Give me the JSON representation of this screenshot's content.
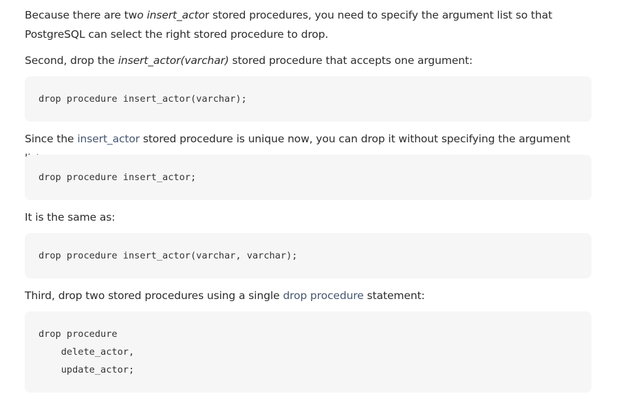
{
  "p1": {
    "t1": "Because there are tw",
    "t2": "o insert_acto",
    "t3": "r stored procedures, you need to specify the argument list so that",
    "t4": "PostgreSQL can select the right stored procedure to drop."
  },
  "p2": {
    "t1": "Second, drop the ",
    "t2": "insert_actor(varchar)",
    "t3": " stored procedure that accepts one argument:"
  },
  "code1": "drop procedure insert_actor(varchar);",
  "p3": {
    "t1": "Since the ",
    "t2": "insert_actor",
    "t3": " stored procedure is unique now, you can drop it without specifying the argument list:"
  },
  "code2": "drop procedure insert_actor;",
  "p4": {
    "t1": "It is the same as:"
  },
  "code3": "drop procedure insert_actor(varchar, varchar);",
  "p5": {
    "t1": "Third, drop two stored procedures using a single ",
    "t2": "drop procedure",
    "t3": " statement:"
  },
  "code4": {
    "line1": "drop procedure",
    "line2": "    delete_actor,",
    "line3": "    update_actor;"
  }
}
